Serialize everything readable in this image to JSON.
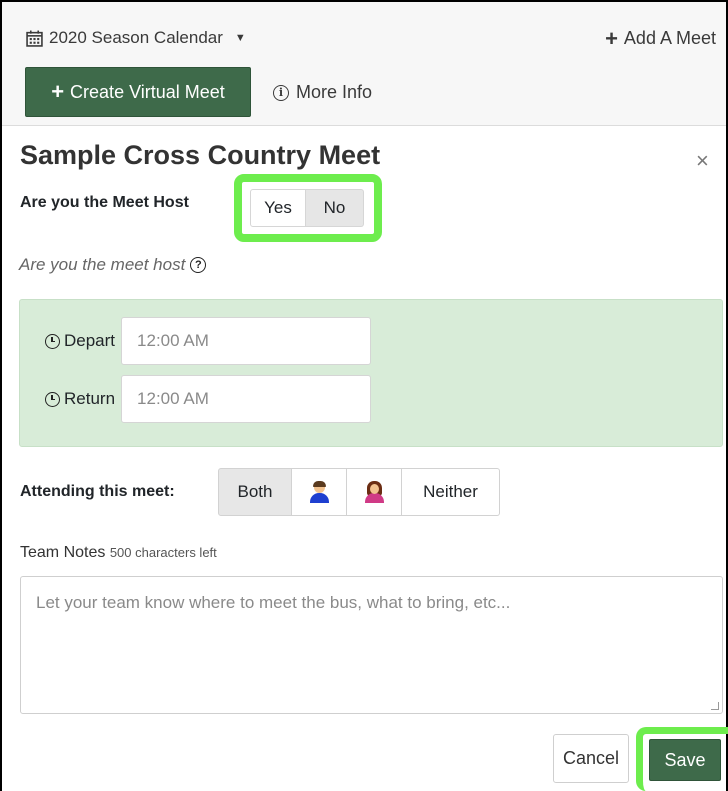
{
  "header": {
    "calendar_label": "2020 Season Calendar",
    "add_meet_label": "Add A Meet",
    "create_virtual_label": "Create Virtual Meet",
    "more_info_label": "More Info"
  },
  "modal": {
    "title": "Sample Cross Country Meet",
    "close_symbol": "×",
    "host_question": "Are you the Meet Host",
    "host_options": [
      "Yes",
      "No"
    ],
    "host_selected": "No",
    "host_help": "Are you the meet host",
    "depart_label": "Depart",
    "depart_placeholder": "12:00 AM",
    "return_label": "Return",
    "return_placeholder": "12:00 AM",
    "attending_label": "Attending this meet:",
    "attending_options": [
      "Both",
      "boys-icon",
      "girls-icon",
      "Neither"
    ],
    "attending_selected": "Both",
    "notes_label": "Team Notes",
    "notes_counter": "500 characters left",
    "notes_placeholder": "Let your team know where to meet the bus, what to bring, etc...",
    "cancel_label": "Cancel",
    "save_label": "Save"
  },
  "colors": {
    "primary_green": "#3e6a4a",
    "highlight_green": "#6ded4d",
    "panel_green": "#d8ecd8"
  }
}
